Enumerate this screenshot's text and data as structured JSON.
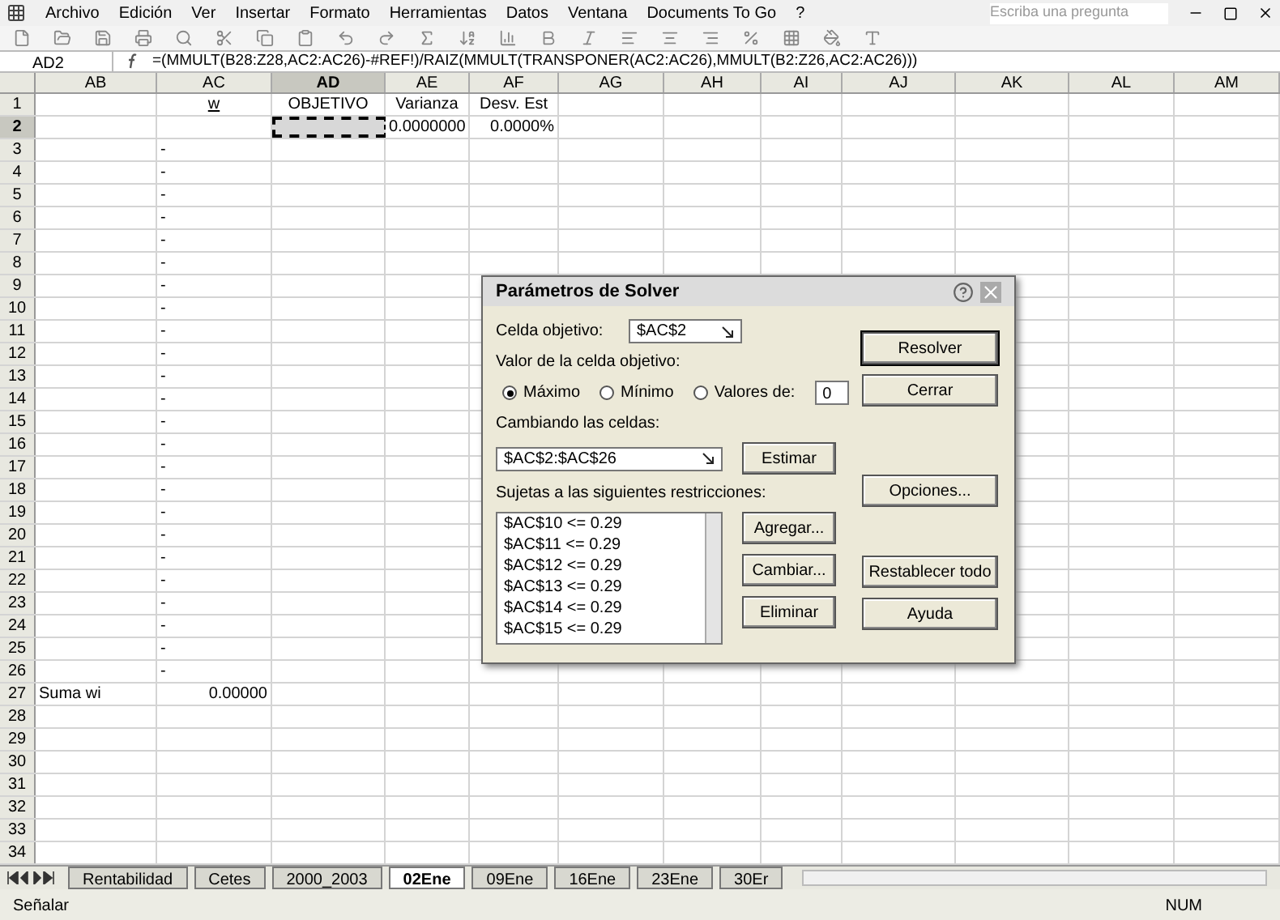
{
  "menu_bar": {
    "items": [
      "Archivo",
      "Edición",
      "Ver",
      "Insertar",
      "Formato",
      "Herramientas",
      "Datos",
      "Ventana",
      "Documents To Go",
      "?"
    ],
    "help_box": {
      "placeholder": "Escriba una pregunta"
    }
  },
  "formula_bar": {
    "name_box": "AD2",
    "formula": "=(MMULT(B28:Z28,AC2:AC26)-#REF!)/RAIZ(MMULT(TRANSPONER(AC2:AC26),MMULT(B2:Z26,AC2:AC26)))"
  },
  "sheet": {
    "columns": [
      {
        "label": "AB",
        "selected": false
      },
      {
        "label": "AC",
        "selected": false
      },
      {
        "label": "AD",
        "selected": true
      },
      {
        "label": "AE",
        "selected": false
      },
      {
        "label": "AF",
        "selected": false
      },
      {
        "label": "AG",
        "selected": false
      },
      {
        "label": "AH",
        "selected": false
      },
      {
        "label": "AI",
        "selected": false
      },
      {
        "label": "AJ",
        "selected": false
      },
      {
        "label": "AK",
        "selected": false
      },
      {
        "label": "AL",
        "selected": false
      },
      {
        "label": "AM",
        "selected": false
      }
    ],
    "rows": [
      {
        "number": "1",
        "selected": false,
        "cells": {
          "AC": "w",
          "AD": "OBJETIVO",
          "AE": "Varianza",
          "AF": "Desv. Est"
        }
      },
      {
        "number": "2",
        "selected": true,
        "cells": {
          "AE": "0.0000000",
          "AF": "0.0000%"
        }
      },
      {
        "number": "3",
        "selected": false,
        "cells": {
          "AC": "-"
        }
      },
      {
        "number": "4",
        "selected": false,
        "cells": {
          "AC": "-"
        }
      },
      {
        "number": "5",
        "selected": false,
        "cells": {
          "AC": "-"
        }
      },
      {
        "number": "6",
        "selected": false,
        "cells": {
          "AC": "-"
        }
      },
      {
        "number": "7",
        "selected": false,
        "cells": {
          "AC": "-"
        }
      },
      {
        "number": "8",
        "selected": false,
        "cells": {
          "AC": "-"
        }
      },
      {
        "number": "9",
        "selected": false,
        "cells": {
          "AC": "-"
        }
      },
      {
        "number": "10",
        "selected": false,
        "cells": {
          "AC": "-"
        }
      },
      {
        "number": "11",
        "selected": false,
        "cells": {
          "AC": "-"
        }
      },
      {
        "number": "12",
        "selected": false,
        "cells": {
          "AC": "-"
        }
      },
      {
        "number": "13",
        "selected": false,
        "cells": {
          "AC": "-"
        }
      },
      {
        "number": "14",
        "selected": false,
        "cells": {
          "AC": "-"
        }
      },
      {
        "number": "15",
        "selected": false,
        "cells": {
          "AC": "-"
        }
      },
      {
        "number": "16",
        "selected": false,
        "cells": {
          "AC": "-"
        }
      },
      {
        "number": "17",
        "selected": false,
        "cells": {
          "AC": "-"
        }
      },
      {
        "number": "18",
        "selected": false,
        "cells": {
          "AC": "-"
        }
      },
      {
        "number": "19",
        "selected": false,
        "cells": {
          "AC": "-"
        }
      },
      {
        "number": "20",
        "selected": false,
        "cells": {
          "AC": "-"
        }
      },
      {
        "number": "21",
        "selected": false,
        "cells": {
          "AC": "-"
        }
      },
      {
        "number": "22",
        "selected": false,
        "cells": {
          "AC": "-"
        }
      },
      {
        "number": "23",
        "selected": false,
        "cells": {
          "AC": "-"
        }
      },
      {
        "number": "24",
        "selected": false,
        "cells": {
          "AC": "-"
        }
      },
      {
        "number": "25",
        "selected": false,
        "cells": {
          "AC": "-"
        }
      },
      {
        "number": "26",
        "selected": false,
        "cells": {
          "AC": "-"
        }
      },
      {
        "number": "27",
        "selected": false,
        "cells": {
          "AB": "Suma wi",
          "AC": "0.00000"
        }
      },
      {
        "number": "28",
        "selected": false,
        "cells": {}
      },
      {
        "number": "29",
        "selected": false,
        "cells": {}
      },
      {
        "number": "30",
        "selected": false,
        "cells": {}
      },
      {
        "number": "31",
        "selected": false,
        "cells": {}
      },
      {
        "number": "32",
        "selected": false,
        "cells": {}
      },
      {
        "number": "33",
        "selected": false,
        "cells": {}
      },
      {
        "number": "34",
        "selected": false,
        "cells": {}
      }
    ]
  },
  "sheet_tabs": [
    {
      "label": "Rentabilidad",
      "selected": false
    },
    {
      "label": "Cetes",
      "selected": false
    },
    {
      "label": "2000_2003",
      "selected": false
    },
    {
      "label": "02Ene",
      "selected": true
    },
    {
      "label": "09Ene",
      "selected": false
    },
    {
      "label": "16Ene",
      "selected": false
    },
    {
      "label": "23Ene",
      "selected": false
    },
    {
      "label": "30Er",
      "selected": false
    }
  ],
  "status_bar": {
    "mode": "Señalar",
    "num_lock": "NUM"
  },
  "dialog": {
    "title": "Parámetros de Solver",
    "target_label": "Celda objetivo:",
    "target_value": "$AC$2",
    "value_label": "Valor de la celda objetivo:",
    "options": [
      {
        "label": "Máximo",
        "selected": true
      },
      {
        "label": "Mínimo",
        "selected": false
      },
      {
        "label": "Valores de:",
        "selected": false
      }
    ],
    "value_of": "0",
    "changing_label": "Cambiando las celdas:",
    "changing_value": "$AC$2:$AC$26",
    "estimate_button": "Estimar",
    "constraints_label": "Sujetas a las siguientes restricciones:",
    "constraints": [
      "$AC$10 <= 0.29",
      "$AC$11 <= 0.29",
      "$AC$12 <= 0.29",
      "$AC$13 <= 0.29",
      "$AC$14 <= 0.29",
      "$AC$15 <= 0.29"
    ],
    "list_buttons": [
      "Agregar...",
      "Cambiar...",
      "Eliminar"
    ],
    "side_buttons": [
      "Resolver",
      "Cerrar",
      "Opciones...",
      "Restablecer todo",
      "Ayuda"
    ]
  }
}
